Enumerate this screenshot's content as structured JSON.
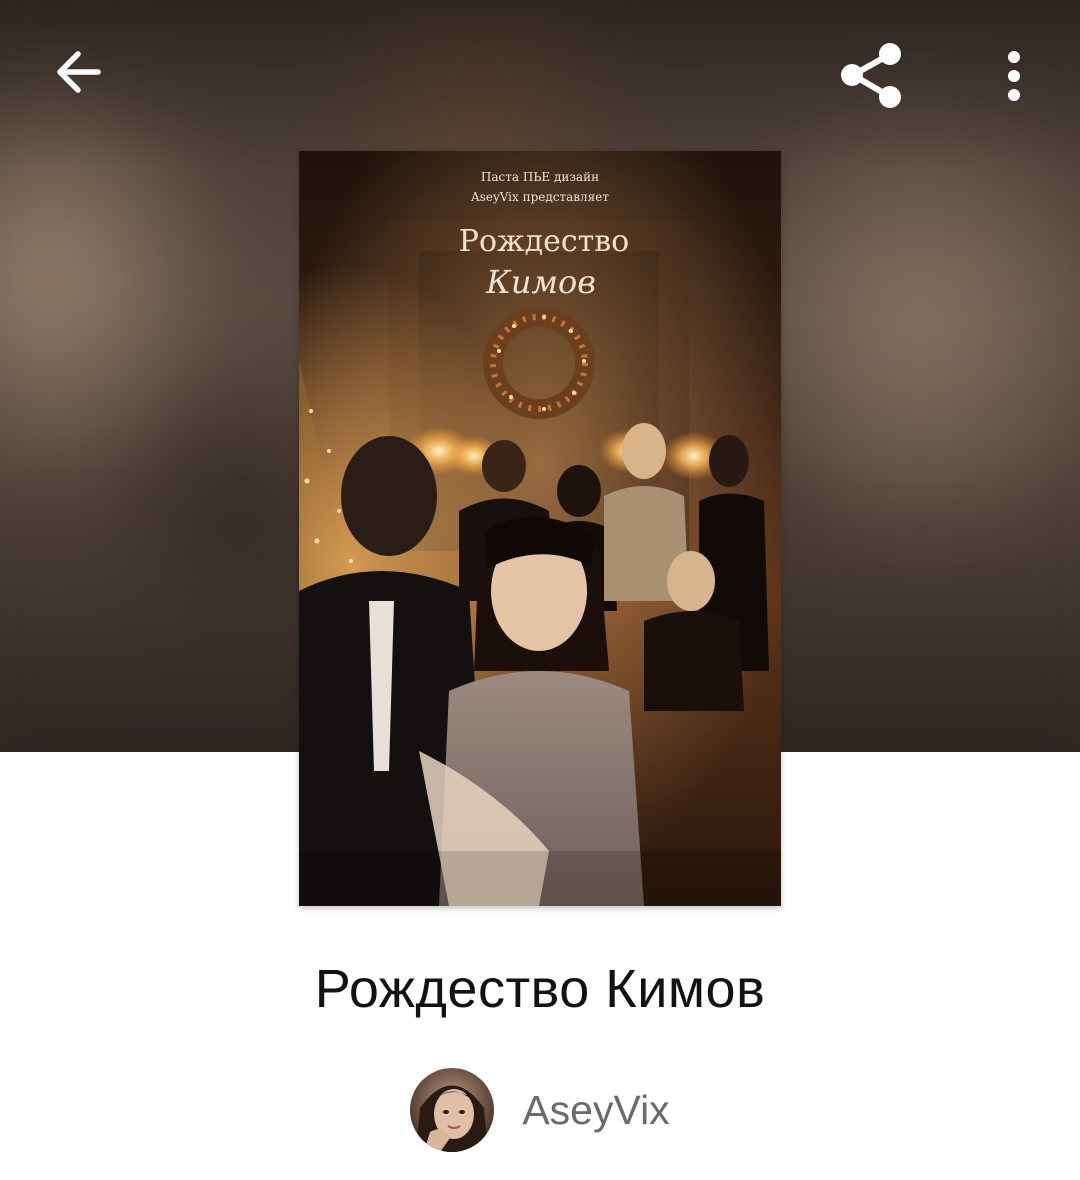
{
  "toolbar": {
    "back_icon": "arrow-left-icon",
    "share_icon": "share-icon",
    "more_icon": "more-vertical-icon",
    "icon_color": "#ffffff"
  },
  "cover": {
    "tagline_line1": "Паста ПЬЕ дизайн",
    "tagline_line2": "AseyVix представляет",
    "title_line1": "Рождество",
    "title_line2": "Кимов",
    "accent_color": "#e8b27a"
  },
  "story": {
    "title": "Рождество Кимов"
  },
  "author": {
    "name": "AseyVix",
    "avatar_icon": "avatar-photo"
  }
}
